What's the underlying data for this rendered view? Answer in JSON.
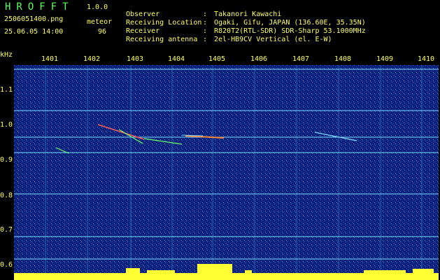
{
  "app": {
    "title": "HROFFT",
    "version": "1.0.0"
  },
  "file": {
    "name": "2506051400.png",
    "datetime": "25.06.05 14:00"
  },
  "meteor": {
    "label": "meteor",
    "count": "96"
  },
  "info": [
    {
      "key": "Observer",
      "value": "Takanori Kawachi"
    },
    {
      "key": "Receiving Location",
      "value": "Ogaki, Gifu, JAPAN (136.60E, 35.35N)"
    },
    {
      "key": "Receiver",
      "value": "R820T2(RTL-SDR) SDR-Sharp 53.1000MHz"
    },
    {
      "key": "Receiving antenna",
      "value": "2el-HB9CV Vertical (el. E-W)"
    }
  ],
  "axis": {
    "unit": "kHz",
    "x_ticks": [
      "1401",
      "1402",
      "1403",
      "1404",
      "1405",
      "1406",
      "1407",
      "1408",
      "1409",
      "1410"
    ],
    "y_ticks": [
      "1.1",
      "1.0",
      "0.9",
      "0.8",
      "0.7",
      "0.6"
    ]
  },
  "colors": {
    "background": "#000000",
    "plot_background": "#0a1f7a",
    "header_text": "#ffff66",
    "title_text": "#5bff5b",
    "carrier_line": "#7fd6ff",
    "signal_bar": "#ffff33"
  }
}
